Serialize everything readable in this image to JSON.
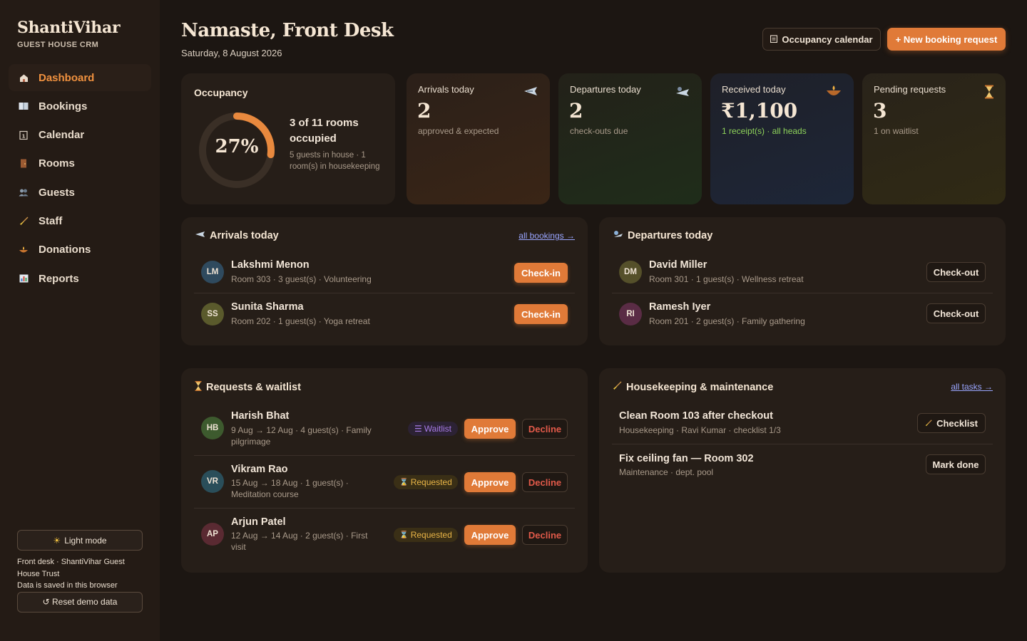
{
  "brand": {
    "title": "ShantiVihar",
    "subtitle": "GUEST HOUSE CRM"
  },
  "nav": [
    {
      "label": "Dashboard",
      "icon": "home-icon",
      "active": true
    },
    {
      "label": "Bookings",
      "icon": "book-icon"
    },
    {
      "label": "Calendar",
      "icon": "calendar-icon"
    },
    {
      "label": "Rooms",
      "icon": "door-icon"
    },
    {
      "label": "Guests",
      "icon": "people-icon"
    },
    {
      "label": "Staff",
      "icon": "broom-icon"
    },
    {
      "label": "Donations",
      "icon": "diya-icon"
    },
    {
      "label": "Reports",
      "icon": "chart-icon"
    }
  ],
  "sidebar_footer": {
    "theme_button": "Light mode",
    "note_line1": "Front desk · ShantiVihar Guest House Trust",
    "note_line2": "Data is saved in this browser",
    "reset_button": "↺ Reset demo data"
  },
  "header": {
    "greeting": "Namaste, Front Desk",
    "date": "Saturday, 8 August 2026",
    "calendar_button": "Occupancy calendar",
    "new_button": "+ New booking request"
  },
  "occupancy": {
    "title": "Occupancy",
    "percent_label": "27%",
    "fraction": 0.27,
    "main": "3 of 11 rooms occupied",
    "sub": "5 guests in house · 1 room(s) in housekeeping"
  },
  "stats": {
    "arrivals": {
      "label": "Arrivals today",
      "value": "2",
      "sub": "approved & expected",
      "icon": "traveler-icon"
    },
    "departures": {
      "label": "Departures today",
      "value": "2",
      "sub": "check-outs due",
      "icon": "wave-icon"
    },
    "received": {
      "label": "Received today",
      "value": "₹1,100",
      "sub": "1 receipt(s) · all heads",
      "icon": "diya-icon"
    },
    "pending": {
      "label": "Pending requests",
      "value": "3",
      "sub": "1 on waitlist",
      "icon": "hourglass-icon"
    }
  },
  "arrivals": {
    "title": "Arrivals today",
    "link": "all bookings →",
    "rows": [
      {
        "initials": "LM",
        "name": "Lakshmi Menon",
        "meta": "Room 303 · 3 guest(s) · Volunteering",
        "action": "Check-in",
        "color": "#2f4a5e"
      },
      {
        "initials": "SS",
        "name": "Sunita Sharma",
        "meta": "Room 202 · 1 guest(s) · Yoga retreat",
        "action": "Check-in",
        "color": "#5a5a2c"
      }
    ]
  },
  "departures": {
    "title": "Departures today",
    "rows": [
      {
        "initials": "DM",
        "name": "David Miller",
        "meta": "Room 301 · 1 guest(s) · Wellness retreat",
        "action": "Check-out",
        "color": "#55502a"
      },
      {
        "initials": "RI",
        "name": "Ramesh Iyer",
        "meta": "Room 201 · 2 guest(s) · Family gathering",
        "action": "Check-out",
        "color": "#5a2c45"
      }
    ]
  },
  "requests": {
    "title": "Requests & waitlist",
    "approve": "Approve",
    "decline": "Decline",
    "rows": [
      {
        "initials": "HB",
        "name": "Harish Bhat",
        "meta": "9 Aug → 12 Aug · 4 guest(s) · Family pilgrimage",
        "status": "Waitlist",
        "color": "#3d5a2e"
      },
      {
        "initials": "VR",
        "name": "Vikram Rao",
        "meta": "15 Aug → 18 Aug · 1 guest(s) · Meditation course",
        "status": "Requested",
        "color": "#2a4e5a"
      },
      {
        "initials": "AP",
        "name": "Arjun Patel",
        "meta": "12 Aug → 14 Aug · 2 guest(s) · First visit",
        "status": "Requested",
        "color": "#5a2a32"
      }
    ]
  },
  "housekeeping": {
    "title": "Housekeeping & maintenance",
    "link": "all tasks →",
    "rows": [
      {
        "title": "Clean Room 103 after checkout",
        "meta": "Housekeeping · Ravi Kumar · checklist 1/3",
        "action": "Checklist"
      },
      {
        "title": "Fix ceiling fan — Room 302",
        "meta": "Maintenance · dept. pool",
        "action": "Mark done"
      }
    ]
  },
  "colors": {
    "accent": "#e07a38",
    "accent_text": "#f0913f",
    "link": "#9aa6ff",
    "positive": "#8ed35a",
    "danger": "#e25a4a"
  }
}
